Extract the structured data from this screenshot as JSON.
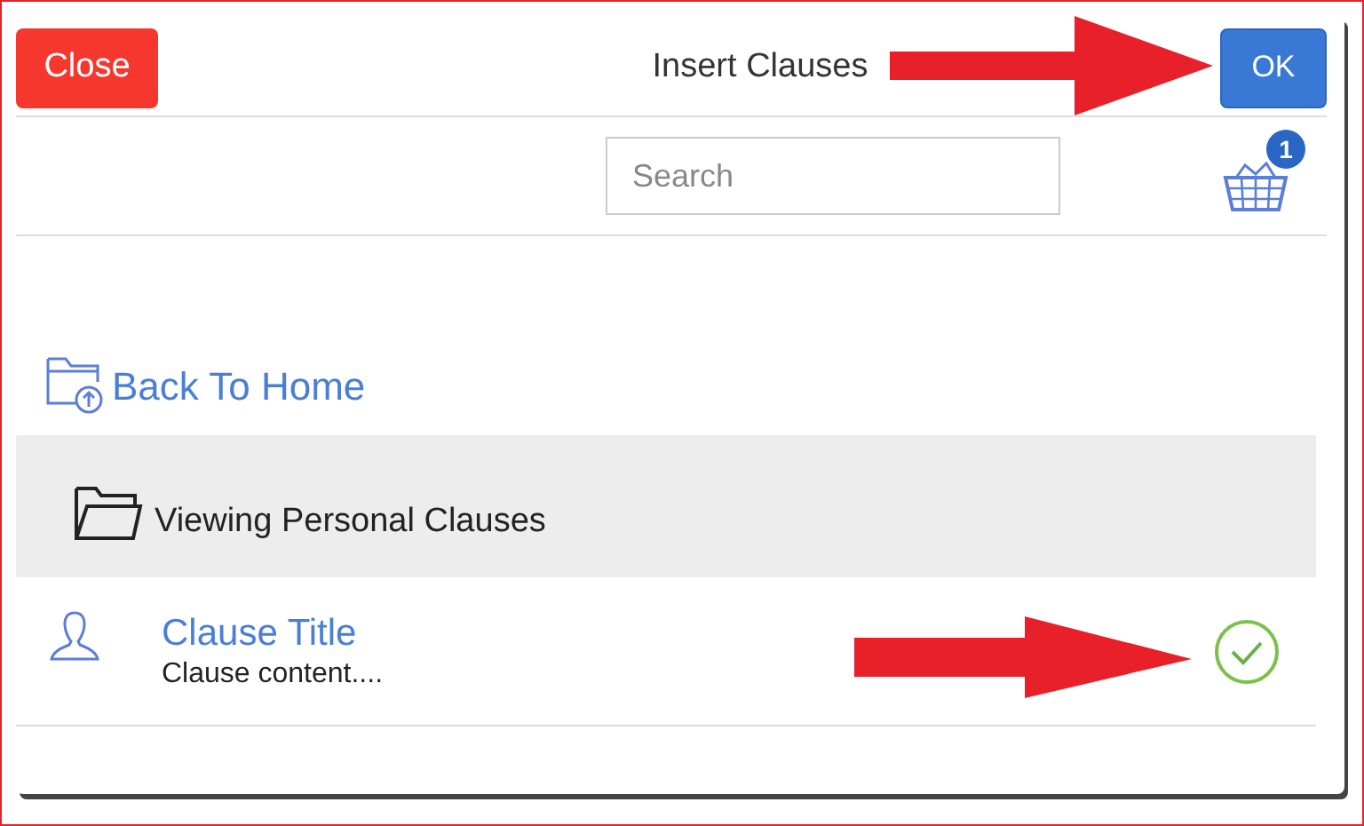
{
  "header": {
    "close_button": "Close",
    "title": "Insert Clauses",
    "ok_button": "OK"
  },
  "toolbar": {
    "search": {
      "placeholder": "Search"
    },
    "basket_count": "1"
  },
  "back_link": "Back To Home",
  "folder": {
    "label": "Viewing Personal Clauses"
  },
  "clauses": [
    {
      "title": "Clause Title",
      "content": "Clause content....",
      "selected": true
    }
  ]
}
